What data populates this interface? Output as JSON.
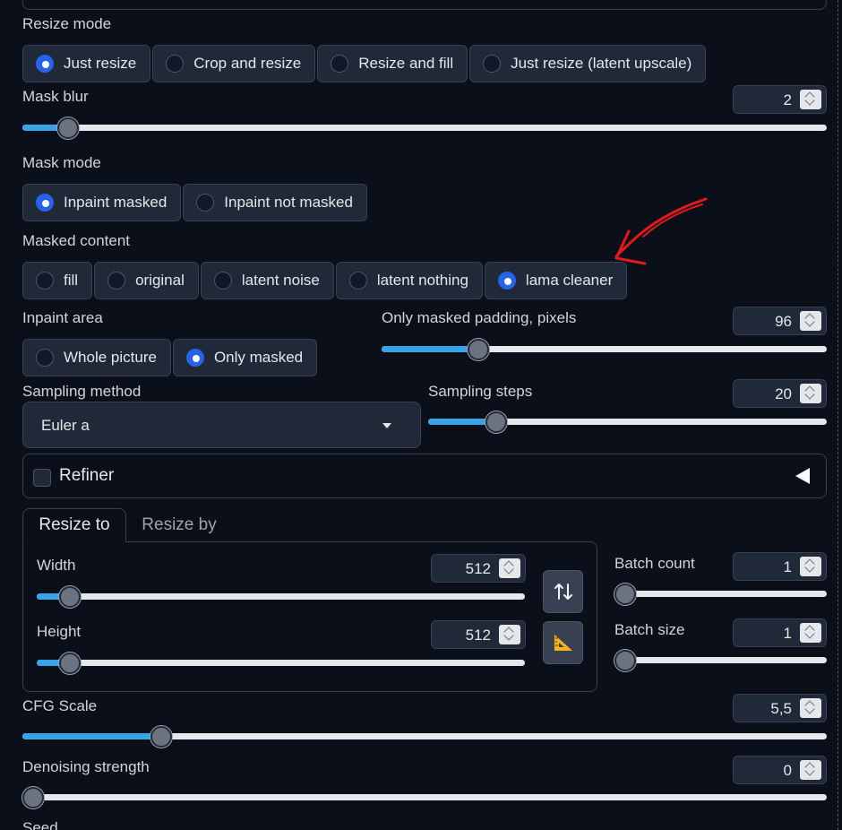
{
  "resize_mode": {
    "label": "Resize mode",
    "options": [
      "Just resize",
      "Crop and resize",
      "Resize and fill",
      "Just resize (latent upscale)"
    ],
    "selected": 0
  },
  "mask_blur": {
    "label": "Mask blur",
    "value": "2",
    "fraction": 0.045
  },
  "mask_mode": {
    "label": "Mask mode",
    "options": [
      "Inpaint masked",
      "Inpaint not masked"
    ],
    "selected": 0
  },
  "masked_content": {
    "label": "Masked content",
    "options": [
      "fill",
      "original",
      "latent noise",
      "latent nothing",
      "lama cleaner"
    ],
    "selected": 4
  },
  "inpaint_area": {
    "label": "Inpaint area",
    "options": [
      "Whole picture",
      "Only masked"
    ],
    "selected": 1
  },
  "only_masked_padding": {
    "label": "Only masked padding, pixels",
    "value": "96",
    "fraction": 0.203
  },
  "sampling_method": {
    "label": "Sampling method",
    "value": "Euler a"
  },
  "sampling_steps": {
    "label": "Sampling steps",
    "value": "20",
    "fraction": 0.153
  },
  "refiner": {
    "label": "Refiner",
    "checked": false
  },
  "tabs": {
    "resize_to": "Resize to",
    "resize_by": "Resize by",
    "active": "resize_to"
  },
  "width": {
    "label": "Width",
    "value": "512",
    "fraction": 0.048
  },
  "height": {
    "label": "Height",
    "value": "512",
    "fraction": 0.048
  },
  "batch_count": {
    "label": "Batch count",
    "value": "1",
    "fraction": 0.0
  },
  "batch_size": {
    "label": "Batch size",
    "value": "1",
    "fraction": 0.0
  },
  "cfg_scale": {
    "label": "CFG Scale",
    "value": "5,5",
    "fraction": 0.164
  },
  "denoising_strength": {
    "label": "Denoising strength",
    "value": "0",
    "fraction": 0.0
  },
  "seed": {
    "label": "Seed"
  },
  "icons": {
    "swap": "swap-vertical-arrows-icon",
    "aspect": "set-square-ruler-icon",
    "annotation": "red-arrow-annotation"
  },
  "colors": {
    "background": "#0b0f19",
    "accent": "#2563eb",
    "slider_fill": "#38a3e6",
    "annotation": "#e01a1a"
  }
}
